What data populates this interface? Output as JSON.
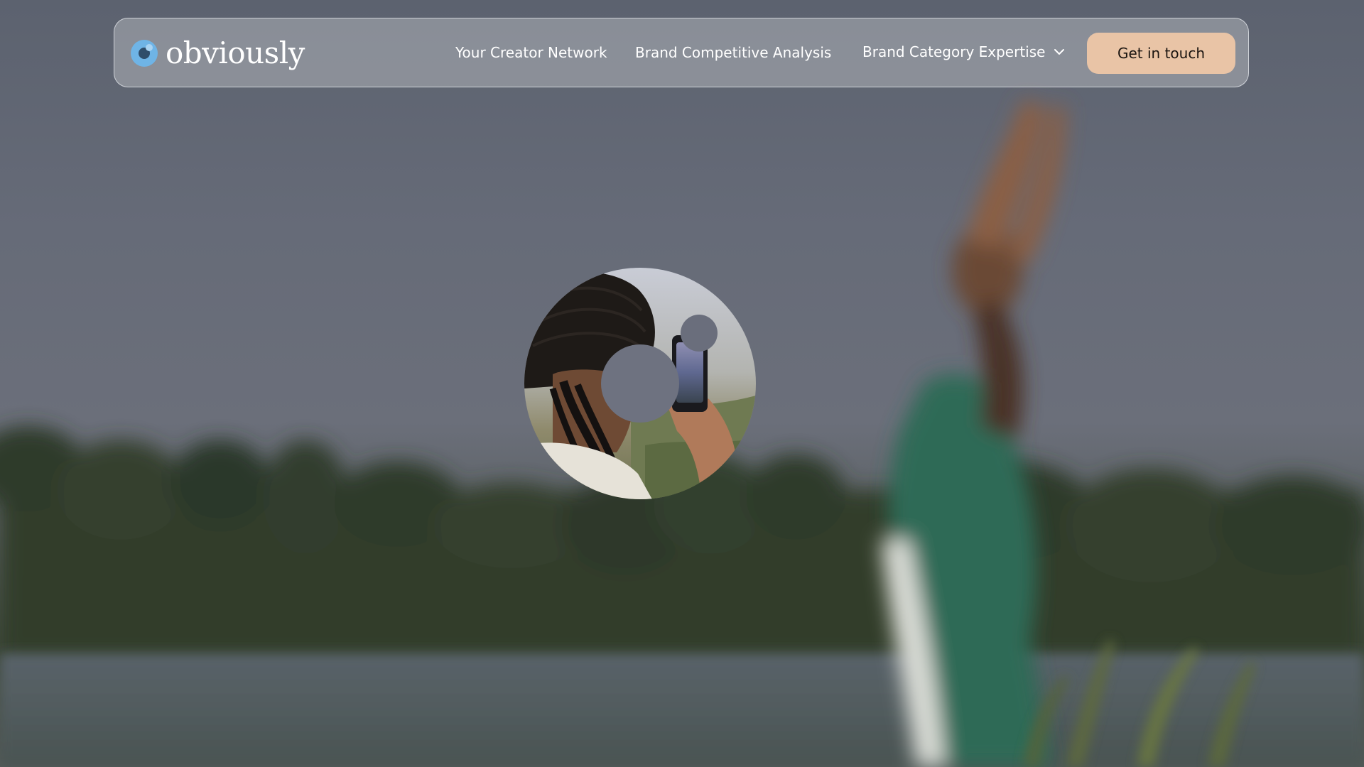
{
  "brand": {
    "name": "obviously",
    "logo_icon": "obviously-eye-logo-icon",
    "accent_color": "#6fb4e6"
  },
  "nav": {
    "links": [
      {
        "label": "Your Creator Network"
      },
      {
        "label": "Brand Competitive Analysis"
      },
      {
        "label": "Brand Category Expertise",
        "icon": "chevron-down-icon"
      }
    ],
    "cta_label": "Get in touch",
    "cta_color": "#e9c4a6"
  },
  "hero": {
    "image": "creator-filming-with-phone-photo",
    "background": "blurred-woman-stretching-by-lake-photo"
  }
}
